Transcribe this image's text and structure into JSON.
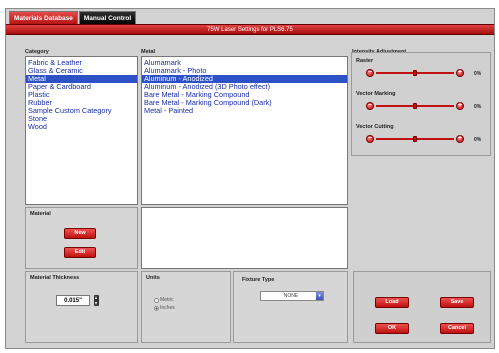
{
  "tabs": [
    {
      "label": "Materials Database",
      "active": true
    },
    {
      "label": "Manual Control",
      "active": false
    }
  ],
  "title": "75W Laser Settings for PLS6.75",
  "category": {
    "label": "Category",
    "items": [
      {
        "label": "Fabric & Leather",
        "selected": false
      },
      {
        "label": "Glass & Ceramic",
        "selected": false
      },
      {
        "label": "Metal",
        "selected": true
      },
      {
        "label": "Paper & Cardboard",
        "selected": false
      },
      {
        "label": "Plastic",
        "selected": false
      },
      {
        "label": "Rubber",
        "selected": false
      },
      {
        "label": "Sample Custom Category",
        "selected": false
      },
      {
        "label": "Stone",
        "selected": false
      },
      {
        "label": "Wood",
        "selected": false
      }
    ]
  },
  "metal": {
    "label": "Metal",
    "items": [
      {
        "label": "Alumamark",
        "selected": false
      },
      {
        "label": "Alumamark - Photo",
        "selected": false
      },
      {
        "label": "Aluminum - Anodized",
        "selected": true
      },
      {
        "label": "Aluminum - Anodized (3D Photo effect)",
        "selected": false
      },
      {
        "label": "Bare Metal - Marking Compound",
        "selected": false
      },
      {
        "label": "Bare Metal - Marking Compound (Dark)",
        "selected": false
      },
      {
        "label": "Metal - Painted",
        "selected": false
      }
    ]
  },
  "intensity": {
    "label": "Intensity Adjustment",
    "sliders": [
      {
        "label": "Raster",
        "value_text": "0%",
        "level": 0.5
      },
      {
        "label": "Vector Marking",
        "value_text": "0%",
        "level": 0.5
      },
      {
        "label": "Vector Cutting",
        "value_text": "0%",
        "level": 0.5
      }
    ]
  },
  "material": {
    "label": "Material",
    "new_label": "New",
    "edit_label": "Edit"
  },
  "thickness": {
    "label": "Material Thickness",
    "value": "0.015\""
  },
  "units": {
    "label": "Units",
    "options": [
      {
        "label": "Metric",
        "checked": false
      },
      {
        "label": "Inches",
        "checked": true
      }
    ]
  },
  "fixture": {
    "label": "Fixture Type",
    "value": "NONE"
  },
  "buttons": {
    "load": "Load",
    "save": "Save",
    "ok": "OK",
    "cancel": "Cancel"
  },
  "colors": {
    "accent_red": "#c01010",
    "selection_blue": "#2d52c8",
    "list_text_blue": "#1a2ca5"
  }
}
